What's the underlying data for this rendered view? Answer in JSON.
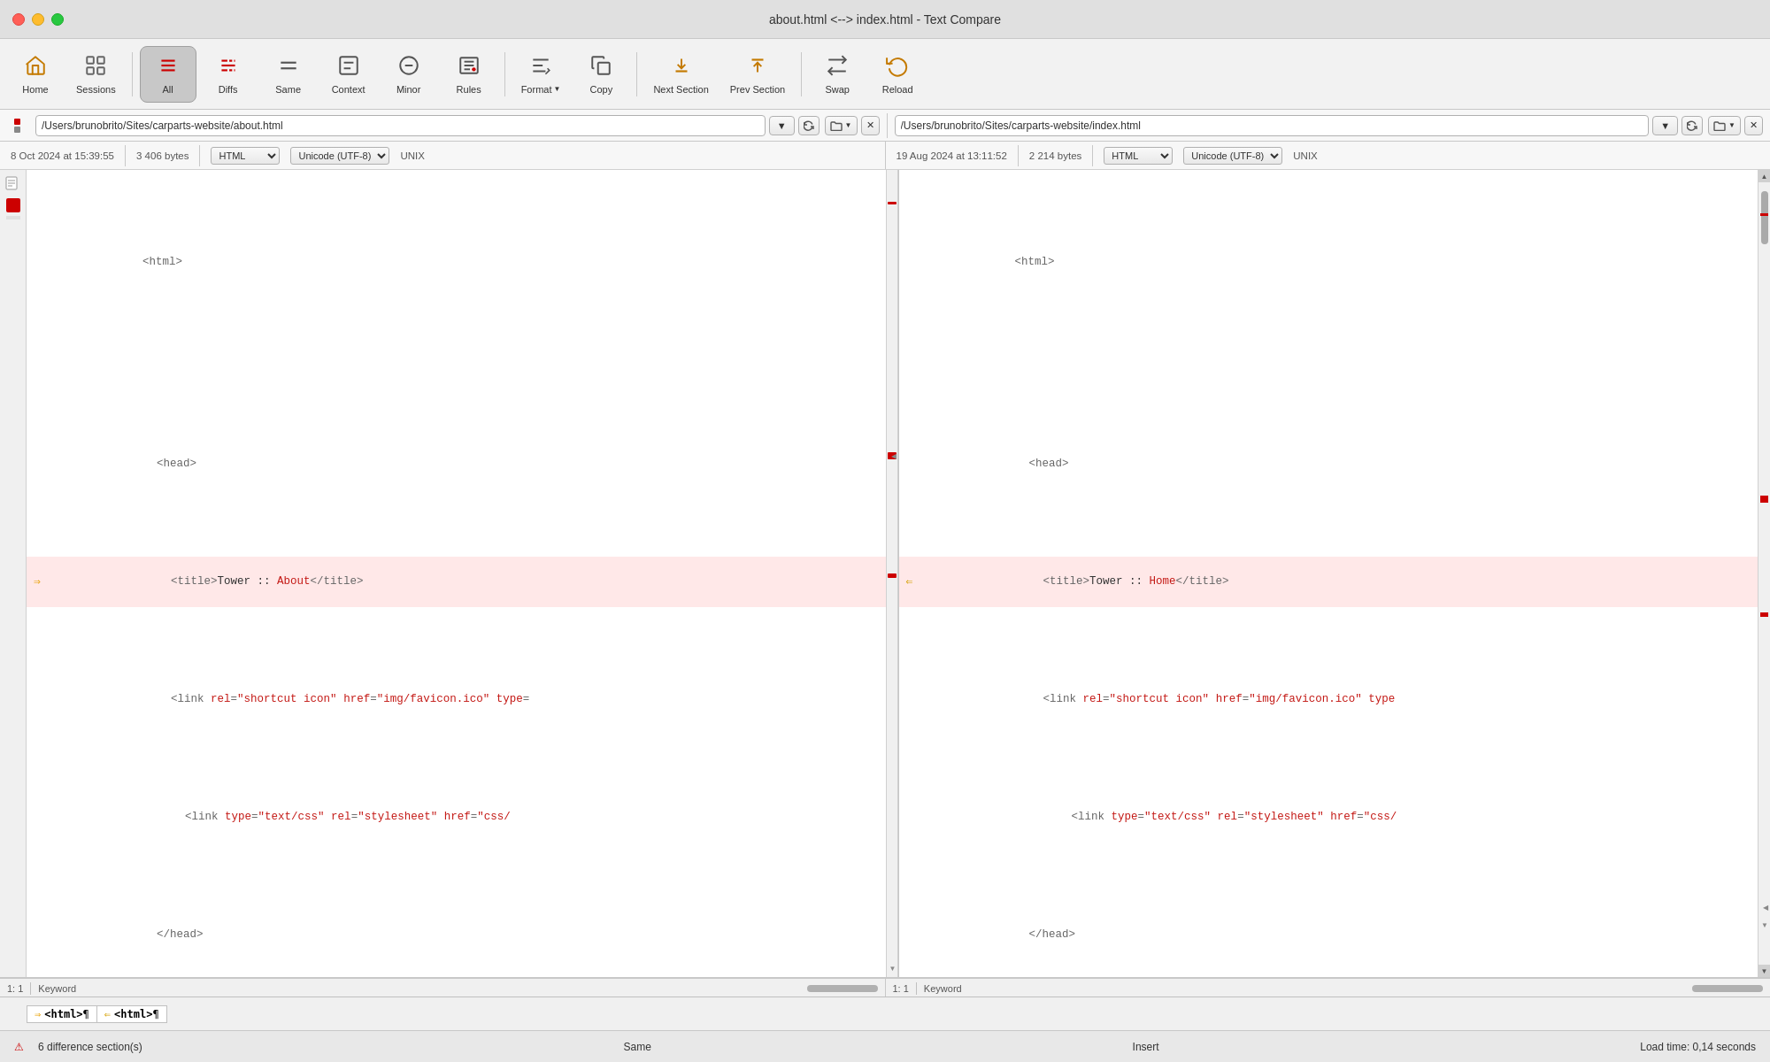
{
  "window": {
    "title": "about.html <--> index.html - Text Compare"
  },
  "toolbar": {
    "home_label": "Home",
    "sessions_label": "Sessions",
    "all_label": "All",
    "diffs_label": "Diffs",
    "same_label": "Same",
    "context_label": "Context",
    "minor_label": "Minor",
    "rules_label": "Rules",
    "format_label": "Format",
    "copy_label": "Copy",
    "next_section_label": "Next Section",
    "prev_section_label": "Prev Section",
    "swap_label": "Swap",
    "reload_label": "Reload"
  },
  "left_pane": {
    "filepath": "/Users/brunobrito/Sites/carparts-website/about.html",
    "date": "8 Oct 2024 at 15:39:55",
    "size": "3 406 bytes",
    "format": "HTML",
    "encoding": "Unicode (UTF-8)",
    "line_ending": "UNIX",
    "position": "1: 1",
    "search_mode": "Keyword"
  },
  "right_pane": {
    "filepath": "/Users/brunobrito/Sites/carparts-website/index.html",
    "date": "19 Aug 2024 at 13:11:52",
    "size": "2 214 bytes",
    "format": "HTML",
    "encoding": "Unicode (UTF-8)",
    "line_ending": "UNIX",
    "position": "1: 1",
    "search_mode": "Keyword"
  },
  "status": {
    "diff_count": "6 difference section(s)",
    "same_label": "Same",
    "insert_label": "Insert",
    "load_time": "Load time: 0,14 seconds"
  },
  "diff_summary": {
    "left_html": "⇒<html>¶",
    "right_html": "⇐<html>¶"
  }
}
